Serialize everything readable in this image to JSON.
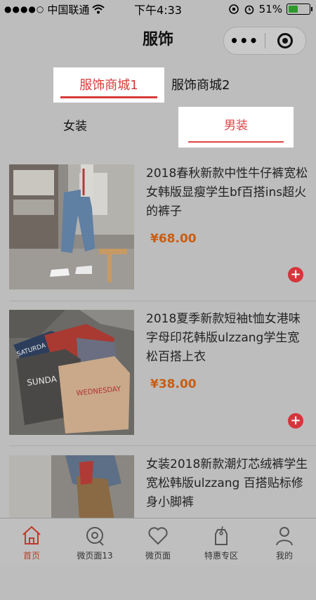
{
  "status_bar": {
    "carrier": "中国联通",
    "time": "下午4:33",
    "battery": "51%",
    "battery_level": 0.51
  },
  "navbar": {
    "title": "服饰",
    "more_icon": "more-dots-icon",
    "close_icon": "target-icon"
  },
  "shop_tabs": [
    {
      "label": "服饰商城1",
      "active": true
    },
    {
      "label": "服饰商城2",
      "active": false
    }
  ],
  "category_tabs": [
    {
      "label": "女装",
      "active": false
    },
    {
      "label": "男装",
      "active": true
    }
  ],
  "products": [
    {
      "title": "2018春秋新款中性牛仔裤宽松女韩版显瘦学生bf百搭ins超火的裤子",
      "price": "¥68.00"
    },
    {
      "title": "2018夏季新款短袖t恤女港味字母印花韩版ulzzang学生宽松百搭上衣",
      "price": "¥38.00"
    },
    {
      "title": "女装2018新款潮灯芯绒裤学生宽松韩版ulzzang 百搭贴标修身小脚裤",
      "price": ""
    }
  ],
  "tabbar": [
    {
      "label": "首页",
      "icon": "home-icon",
      "active": true
    },
    {
      "label": "微页面13",
      "icon": "location-icon",
      "active": false
    },
    {
      "label": "微页面",
      "icon": "heart-icon",
      "active": false
    },
    {
      "label": "特惠专区",
      "icon": "tag-icon",
      "active": false
    },
    {
      "label": "我的",
      "icon": "user-icon",
      "active": false
    }
  ],
  "colors": {
    "accent": "#d73a3a",
    "price": "#c85d12",
    "add_button": "#d6353c"
  }
}
